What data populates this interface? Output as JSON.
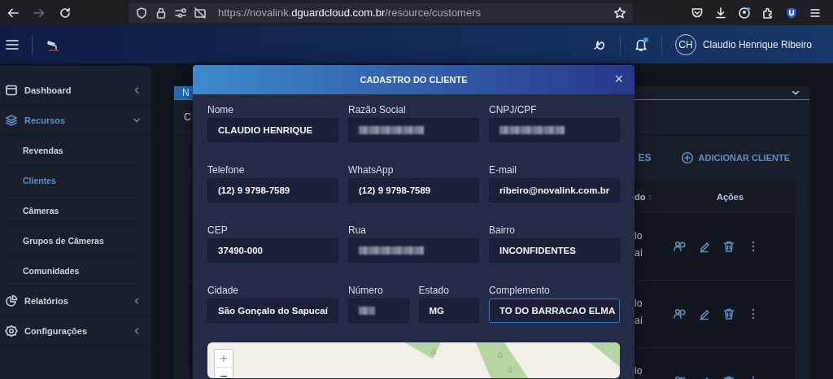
{
  "browser": {
    "url": {
      "prefix": "https://novalink.",
      "domain": "dguardcloud.com.br",
      "path": "/resource/customers"
    },
    "forward_disabled": true
  },
  "app_header": {
    "user_initials": "CH",
    "user_name": "Claudio Henrique Ribeiro",
    "notification_dot": true
  },
  "sidebar": {
    "items": [
      {
        "label": "Dashboard",
        "expanded": false,
        "selected": false
      },
      {
        "label": "Recursos",
        "expanded": true,
        "selected": true,
        "children": [
          {
            "label": "Revendas",
            "selected": false
          },
          {
            "label": "Clientes",
            "selected": true
          },
          {
            "label": "Câmeras",
            "selected": false
          },
          {
            "label": "Grupos de Câmeras",
            "selected": false
          },
          {
            "label": "Comunidades",
            "selected": false
          }
        ]
      },
      {
        "label": "Relatórios",
        "expanded": false,
        "selected": false
      },
      {
        "label": "Configurações",
        "expanded": false,
        "selected": false
      }
    ]
  },
  "page": {
    "tab_label": "N",
    "row_label": "C",
    "button_label": "ES",
    "add_button": "ADICIONAR CLIENTE",
    "table": {
      "columns": [
        {
          "label": "do",
          "sortable": true
        },
        {
          "label": "Ações",
          "sortable": false
        }
      ],
      "rows": [
        {
          "lines": [
            "lo",
            "aí"
          ]
        },
        {
          "lines": [
            "lo",
            "aí"
          ]
        },
        {
          "lines": [
            "lo"
          ]
        }
      ]
    }
  },
  "modal": {
    "title": "CADASTRO DO CLIENTE",
    "close": "×",
    "rows": [
      [
        {
          "label": "Nome",
          "value": "CLAUDIO HENRIQUE",
          "redacted": false,
          "focused": false
        },
        {
          "label": "Razão Social",
          "redacted": true,
          "focused": false
        },
        {
          "label": "CNPJ/CPF",
          "redacted": true,
          "focused": false
        }
      ],
      [
        {
          "label": "Telefone",
          "value": "(12) 9 9798-7589",
          "redacted": false,
          "focused": false
        },
        {
          "label": "WhatsApp",
          "value": "(12) 9 9798-7589",
          "redacted": false,
          "focused": false
        },
        {
          "label": "E-mail",
          "value": "ribeiro@novalink.com.br",
          "redacted": false,
          "focused": false
        }
      ],
      [
        {
          "label": "CEP",
          "value": "37490-000",
          "redacted": false,
          "focused": false
        },
        {
          "label": "Rua",
          "redacted": true,
          "focused": false
        },
        {
          "label": "Bairro",
          "value": "INCONFIDENTES",
          "redacted": false,
          "focused": false
        }
      ],
      [
        {
          "label": "Cidade",
          "value": "São Gonçalo do Sapucaí",
          "redacted": false,
          "focused": false
        },
        {
          "label": "Número",
          "redacted": true,
          "focused": false
        },
        {
          "label": "Estado",
          "value": "MG",
          "redacted": false,
          "focused": false
        },
        {
          "label": "Complemento",
          "value": "TO DO BARRACAO ELMA",
          "redacted": false,
          "focused": true
        }
      ]
    ],
    "map": {
      "zoom_in": "+",
      "zoom_out": "−"
    }
  }
}
